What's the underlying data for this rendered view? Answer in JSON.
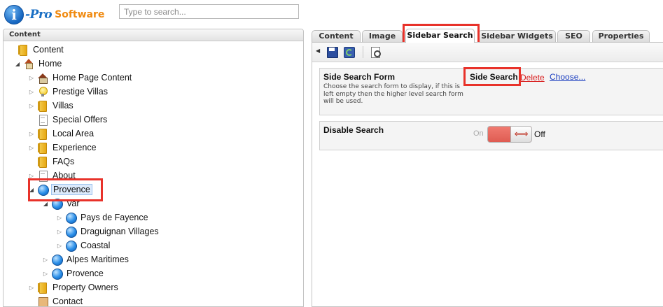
{
  "header": {
    "logo_letter": "i",
    "logo_pro": "-Pro",
    "logo_software": "Software",
    "search_placeholder": "Type to search..."
  },
  "tree_panel": {
    "title": "Content",
    "nodes": [
      {
        "label": "Content",
        "icon": "folder-icon"
      },
      {
        "label": "Home",
        "icon": "home-icon"
      },
      {
        "label": "Home Page Content",
        "icon": "homepage-icon"
      },
      {
        "label": "Prestige Villas",
        "icon": "bulb-icon"
      },
      {
        "label": "Villas",
        "icon": "folder-icon"
      },
      {
        "label": "Special Offers",
        "icon": "page-icon"
      },
      {
        "label": "Local Area",
        "icon": "folder-icon"
      },
      {
        "label": "Experience",
        "icon": "folder-icon"
      },
      {
        "label": "FAQs",
        "icon": "folder-icon"
      },
      {
        "label": "About",
        "icon": "page-icon"
      },
      {
        "label": "Provence",
        "icon": "globe-icon",
        "selected": true
      },
      {
        "label": "Var",
        "icon": "globe-icon"
      },
      {
        "label": "Pays de Fayence",
        "icon": "globe-icon"
      },
      {
        "label": "Draguignan Villages",
        "icon": "globe-icon"
      },
      {
        "label": "Coastal",
        "icon": "globe-icon"
      },
      {
        "label": "Alpes Maritimes",
        "icon": "globe-icon"
      },
      {
        "label": "Provence",
        "icon": "globe-icon"
      },
      {
        "label": "Property Owners",
        "icon": "folder-icon"
      },
      {
        "label": "Contact",
        "icon": "contact-icon"
      }
    ]
  },
  "tabs": [
    "Content",
    "Image",
    "Sidebar Search",
    "Sidebar Widgets",
    "SEO",
    "Properties"
  ],
  "active_tab": "Sidebar Search",
  "toolbar": {
    "icons": [
      "collapse-arrow-icon",
      "save-icon",
      "save-publish-icon",
      "preview-icon"
    ]
  },
  "side_search_form": {
    "title": "Side Search Form",
    "help": "Choose the search form to display, if this is left empty then the higher level search form will be used.",
    "value": "Side Search",
    "delete_label": "Delete",
    "choose_label": "Choose..."
  },
  "disable_search": {
    "title": "Disable Search",
    "on_label": "On",
    "off_label": "Off",
    "state": "Off"
  },
  "colors": {
    "highlight": "#e8322a",
    "delete_link": "#d81c1c",
    "choose_link": "#1c3fc0",
    "switch_fill": "#e0645a",
    "selected_bg": "#dceafb"
  }
}
